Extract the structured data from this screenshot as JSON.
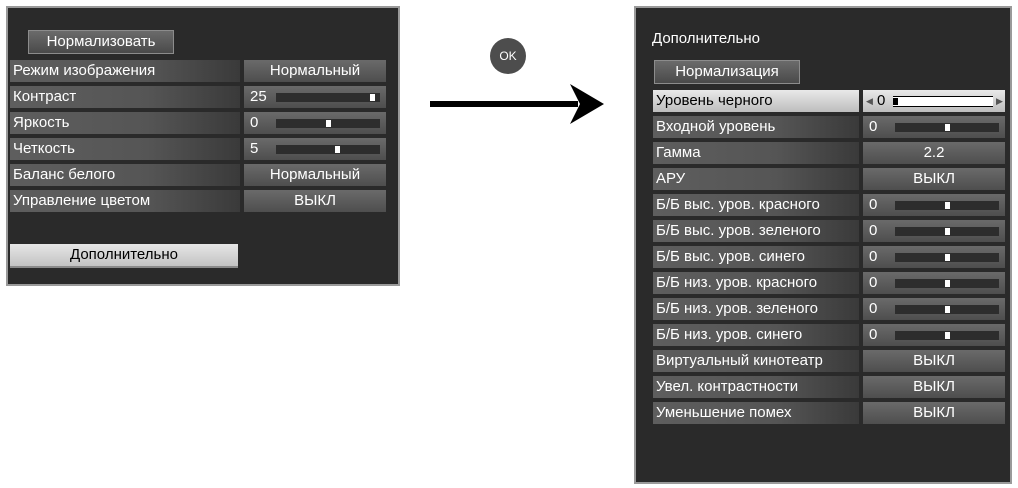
{
  "left_menu": {
    "normalize_label": "Нормализовать",
    "items": [
      {
        "label": "Режим изображения",
        "value": "Нормальный"
      },
      {
        "label": "Контраст",
        "value": "25",
        "level": 0.95
      },
      {
        "label": "Яркость",
        "value": "0",
        "level": 0.5
      },
      {
        "label": "Четкость",
        "value": "5",
        "level": 0.6
      },
      {
        "label": "Баланс белого",
        "value": "Нормальный"
      },
      {
        "label": "Управление цветом",
        "value": "ВЫКЛ"
      }
    ],
    "advanced_label": "Дополнительно"
  },
  "ok_label": "OK",
  "right_menu": {
    "title": "Дополнительно",
    "normalize_label": "Нормализация",
    "items": [
      {
        "label": "Уровень черного",
        "value": "0",
        "level": 0.0
      },
      {
        "label": "Входной уровень",
        "value": "0",
        "level": 0.5
      },
      {
        "label": "Гамма",
        "value": "2.2"
      },
      {
        "label": "АРУ",
        "value": "ВЫКЛ"
      },
      {
        "label": "Б/Б выс. уров. красного",
        "value": "0",
        "level": 0.5
      },
      {
        "label": "Б/Б выс. уров. зеленого",
        "value": "0",
        "level": 0.5
      },
      {
        "label": "Б/Б выс. уров. синего",
        "value": "0",
        "level": 0.5
      },
      {
        "label": "Б/Б низ. уров. красного",
        "value": "0",
        "level": 0.5
      },
      {
        "label": "Б/Б низ. уров. зеленого",
        "value": "0",
        "level": 0.5
      },
      {
        "label": "Б/Б низ. уров. синего",
        "value": "0",
        "level": 0.5
      },
      {
        "label": "Виртуальный кинотеатр",
        "value": "ВЫКЛ"
      },
      {
        "label": "Увел. контрастности",
        "value": "ВЫКЛ"
      },
      {
        "label": "Уменьшение помех",
        "value": "ВЫКЛ"
      }
    ]
  }
}
